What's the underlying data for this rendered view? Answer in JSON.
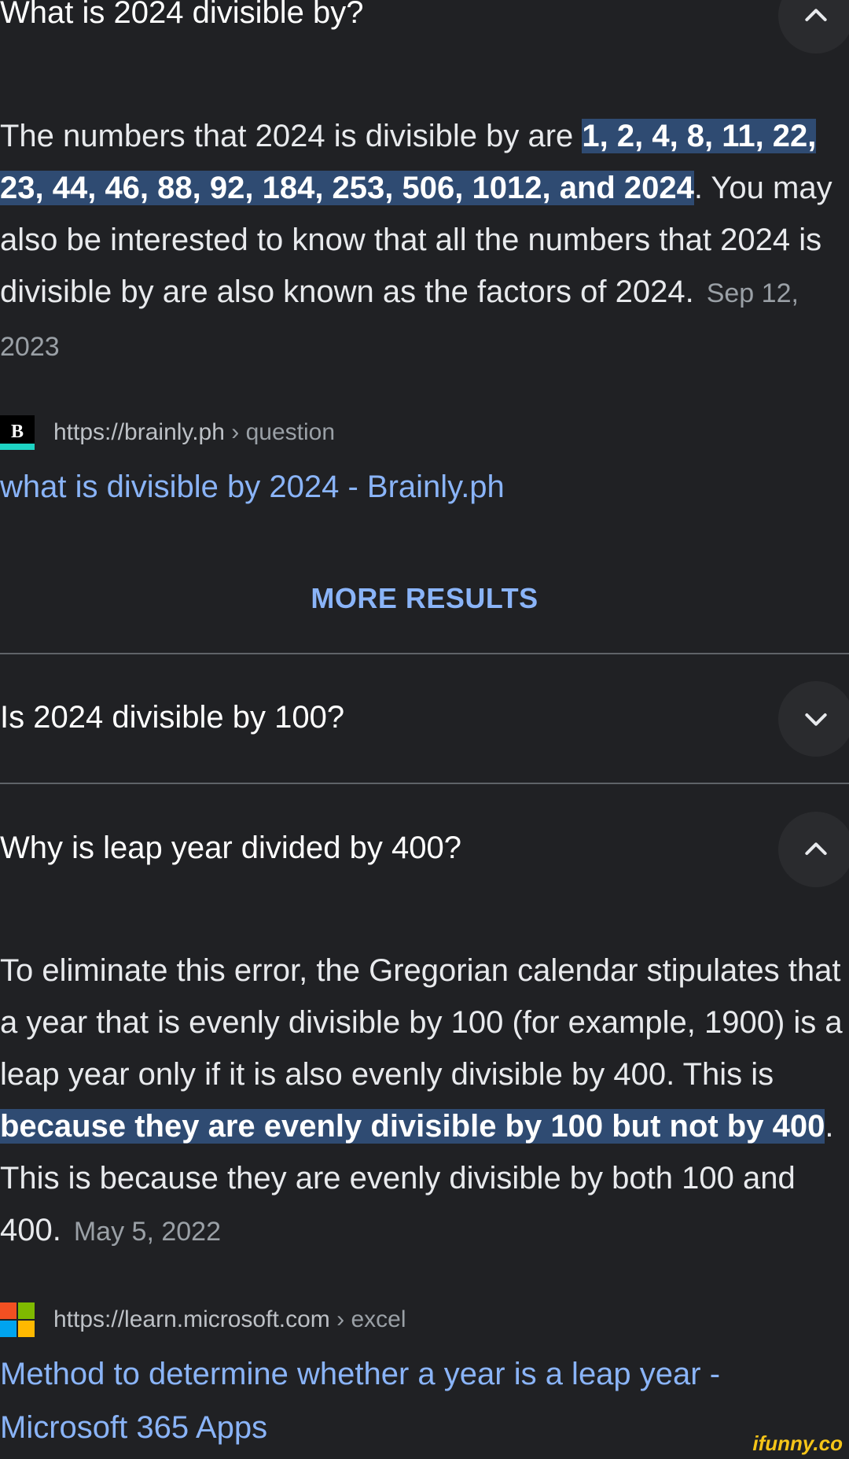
{
  "faq": [
    {
      "question": "What is 2024 divisible by?",
      "expanded": true,
      "answer": {
        "before": "The numbers that 2024 is divisible by are ",
        "highlight": "1, 2, 4, 8, 11, 22, 23, 44, 46, 88, 92, 184, 253, 506, 1012, and 2024",
        "after": ". You may also be interested to know that all the numbers that 2024 is divisible by are also known as the factors of 2024.",
        "date": "Sep 12, 2023"
      },
      "source": {
        "favicon": "brainly-logo-icon",
        "favicon_letter": "B",
        "url": "https://brainly.ph",
        "breadcrumb": "› question",
        "title": "what is divisible by 2024 - Brainly.ph"
      },
      "more_results": "MORE RESULTS"
    },
    {
      "question": "Is 2024 divisible by 100?",
      "expanded": false
    },
    {
      "question": "Why is leap year divided by 400?",
      "expanded": true,
      "answer": {
        "before": "To eliminate this error, the Gregorian calendar stipulates that a year that is evenly divisible by 100 (for example, 1900) is a leap year only if it is also evenly divisible by 400. This is ",
        "highlight": "because they are evenly divisible by 100 but not by 400",
        "after": ". This is because they are evenly divisible by both 100 and 400.",
        "date": "May 5, 2022"
      },
      "source": {
        "favicon": "microsoft-logo-icon",
        "url": "https://learn.microsoft.com",
        "breadcrumb": "› excel",
        "title": "Method to determine whether a year is a leap year - Microsoft 365 Apps"
      }
    }
  ],
  "watermark": "ifunny.co",
  "colors": {
    "background": "#202124",
    "link": "#8ab4f8",
    "highlight": "#2f4b72",
    "divider": "#5f6368"
  }
}
